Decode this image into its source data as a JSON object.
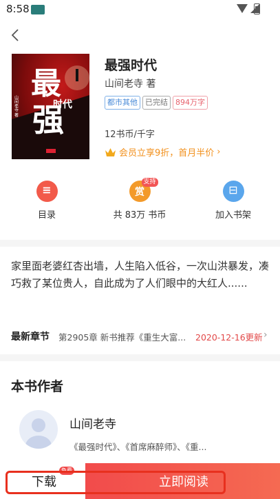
{
  "status": {
    "time": "8:58",
    "app_icon": "news-app-icon"
  },
  "book": {
    "title": "最强时代",
    "author": "山间老寺 著",
    "tags": [
      "都市其他",
      "已完结",
      "894万字"
    ],
    "price": "12书币/千字",
    "vip_text": "会员立享9折，首月半价",
    "cover": {
      "title_big_1": "最",
      "title_big_2": "强",
      "title_small": "时代",
      "author_vertical": "山间老寺 著"
    }
  },
  "actions": {
    "catalog_label": "目录",
    "catalog_glyph": "≡",
    "reward_glyph": "赏",
    "reward_badge": "支持",
    "reward_label": "共 83万 书币",
    "shelf_glyph": "⊟",
    "shelf_label": "加入书架"
  },
  "description": "家里面老婆红杏出墙，人生陷入低谷，一次山洪暴发，凑巧救了某位贵人，自此成为了人们眼中的大红人......",
  "latest": {
    "label": "最新章节",
    "chapter": "第2905章 新书推荐《重生大富...",
    "date": "2020-12-16更新",
    "arrow": "›"
  },
  "author_section": {
    "title": "本书作者",
    "name": "山间老寺",
    "works": "《最强时代》、《首席麻醉师》、《重..."
  },
  "bottom": {
    "download_label": "下载",
    "free_badge": "免费",
    "read_label": "立即阅读"
  },
  "colors": {
    "accent_red": "#f24b4b",
    "vip_orange": "#f2901c",
    "catalog_icon": "#f25a4a",
    "reward_icon": "#f39a2a",
    "shelf_icon": "#5aa6ec",
    "highlight_border": "#e8301e"
  }
}
